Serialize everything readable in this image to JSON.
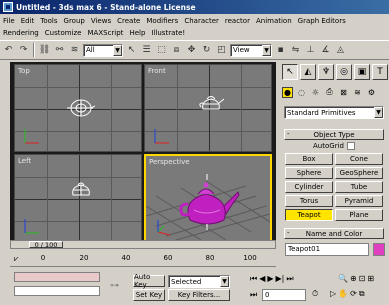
{
  "window": {
    "title": "Untitled - 3ds max 6 - Stand-alone License"
  },
  "menu": {
    "row1": [
      "File",
      "Edit",
      "Tools",
      "Group",
      "Views",
      "Create",
      "Modifiers",
      "Character",
      "reactor",
      "Animation",
      "Graph Editors"
    ],
    "row2": [
      "Rendering",
      "Customize",
      "MAXScript",
      "Help",
      "Illustrate!"
    ]
  },
  "toolbar": {
    "selection_filter": "All",
    "reference_coord": "View"
  },
  "viewports": {
    "top_label": "Top",
    "front_label": "Front",
    "left_label": "Left",
    "perspective_label": "Perspective"
  },
  "command_panel": {
    "category": "Standard Primitives",
    "object_type_header": "Object Type",
    "autogrid_label": "AutoGrid",
    "buttons": [
      "Box",
      "Cone",
      "Sphere",
      "GeoSphere",
      "Cylinder",
      "Tube",
      "Torus",
      "Pyramid",
      "Teapot",
      "Plane"
    ],
    "name_color_header": "Name and Color",
    "object_name": "Teapot01",
    "object_color": "#e040c0"
  },
  "timeline": {
    "frame_display": "0 / 100",
    "ticks": [
      "0",
      "20",
      "40",
      "60",
      "80",
      "100"
    ]
  },
  "animation": {
    "auto_key": "Auto Key",
    "set_key": "Set Key",
    "key_mode": "Selected",
    "key_filters": "Key Filters...",
    "current_frame": "0"
  },
  "colors": {
    "selected_button": "#ffe400",
    "teapot_selected": "#c020c0",
    "teapot_wire": "#ffffff",
    "active_viewport": "#ffd700"
  }
}
